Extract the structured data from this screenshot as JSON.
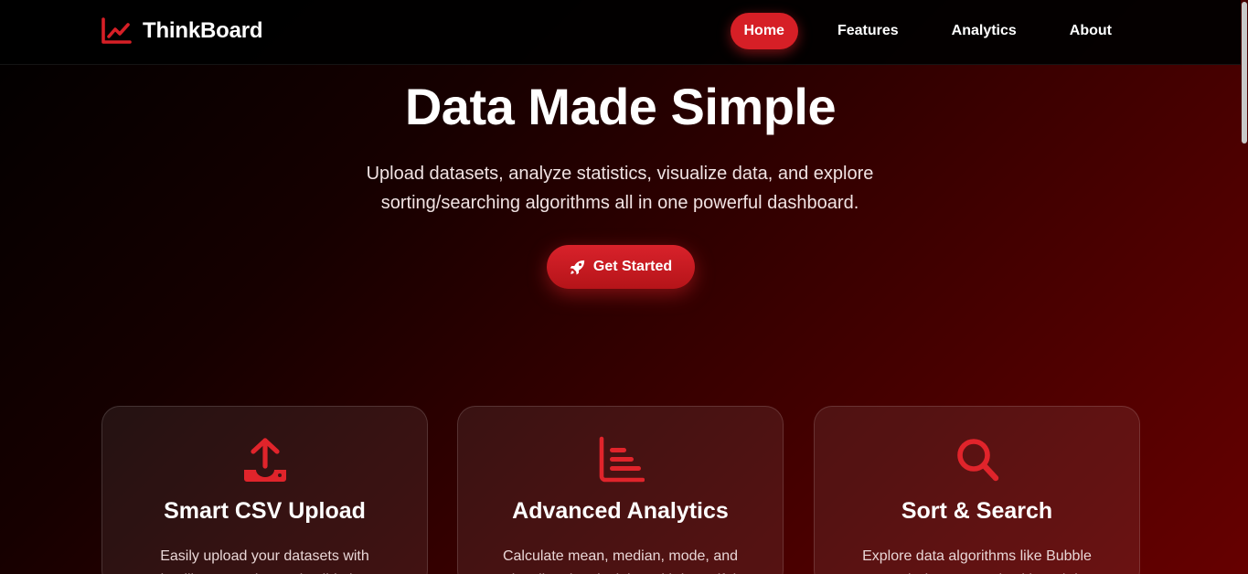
{
  "brand": {
    "name": "ThinkBoard",
    "icon": "chart-line-icon"
  },
  "nav": {
    "items": [
      {
        "label": "Home",
        "active": true
      },
      {
        "label": "Features",
        "active": false
      },
      {
        "label": "Analytics",
        "active": false
      },
      {
        "label": "About",
        "active": false
      }
    ]
  },
  "hero": {
    "title": "Data Made Simple",
    "subtitle": "Upload datasets, analyze statistics, visualize data, and explore sorting/searching algorithms all in one powerful dashboard.",
    "cta_label": "Get Started",
    "cta_icon": "rocket-icon"
  },
  "features": [
    {
      "icon": "upload-icon",
      "title": "Smart CSV Upload",
      "description": "Easily upload your datasets with intelligent parsing and validation"
    },
    {
      "icon": "bar-chart-icon",
      "title": "Advanced Analytics",
      "description": "Calculate mean, median, mode, and visualize data insights with beautiful"
    },
    {
      "icon": "search-icon",
      "title": "Sort & Search",
      "description": "Explore data algorithms like Bubble Sort and Binary Search with real-time"
    }
  ],
  "colors": {
    "accent": "#d61f26",
    "background_dark": "#000000",
    "background_red": "#660000"
  }
}
